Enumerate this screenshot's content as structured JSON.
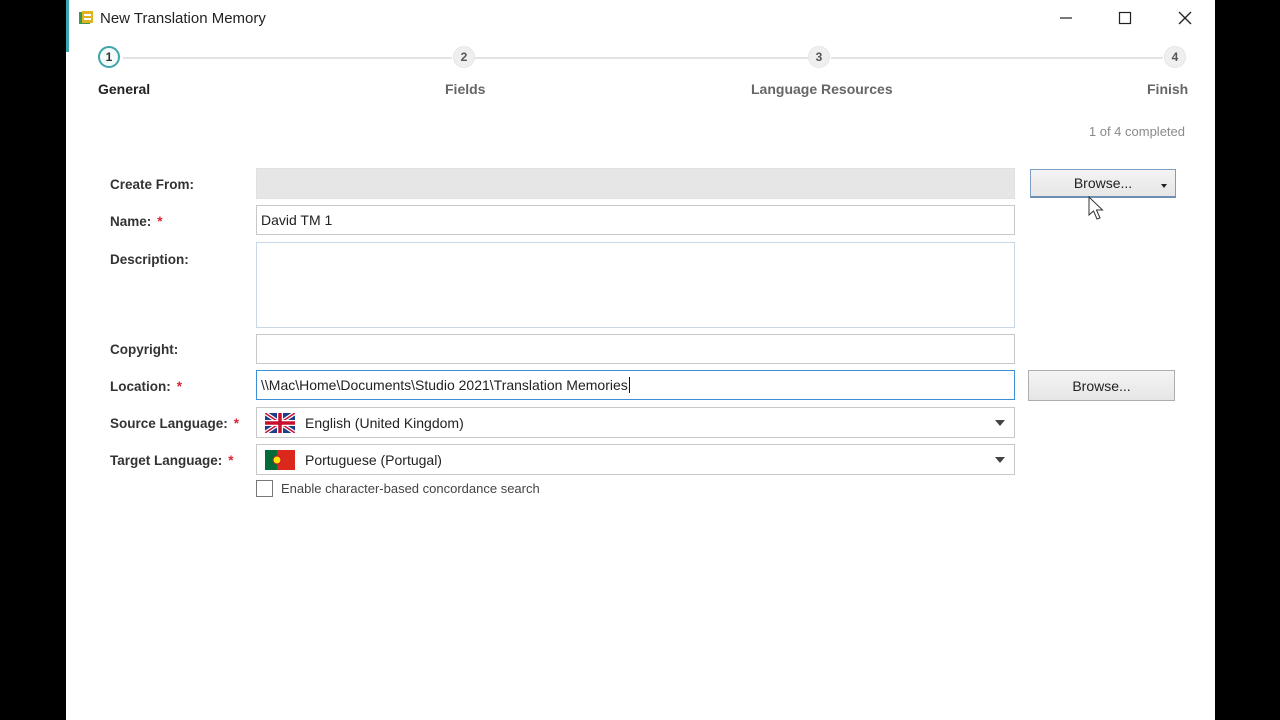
{
  "window": {
    "title": "New Translation Memory"
  },
  "steps": [
    {
      "number": "1",
      "label": "General"
    },
    {
      "number": "2",
      "label": "Fields"
    },
    {
      "number": "3",
      "label": "Language Resources"
    },
    {
      "number": "4",
      "label": "Finish"
    }
  ],
  "progress_text": "1 of 4 completed",
  "form": {
    "create_from": {
      "label": "Create From:",
      "value": "",
      "button": "Browse..."
    },
    "name": {
      "label": "Name:",
      "required": "*",
      "value": "David TM 1"
    },
    "description": {
      "label": "Description:",
      "value": ""
    },
    "copyright": {
      "label": "Copyright:",
      "value": ""
    },
    "location": {
      "label": "Location:",
      "required": "*",
      "value": "\\\\Mac\\Home\\Documents\\Studio 2021\\Translation Memories",
      "button": "Browse..."
    },
    "source_language": {
      "label": "Source Language:",
      "required": "*",
      "value": "English (United Kingdom)"
    },
    "target_language": {
      "label": "Target Language:",
      "required": "*",
      "value": "Portuguese (Portugal)"
    },
    "concordance": {
      "label": "Enable character-based concordance search",
      "checked": false
    }
  },
  "icons": {
    "app": "translation-memory-icon",
    "source_flag": "uk-flag-icon",
    "target_flag": "portugal-flag-icon"
  },
  "colors": {
    "accent": "#3ea6aa",
    "required": "#dd2233",
    "focus_border": "#3a8fd6"
  }
}
